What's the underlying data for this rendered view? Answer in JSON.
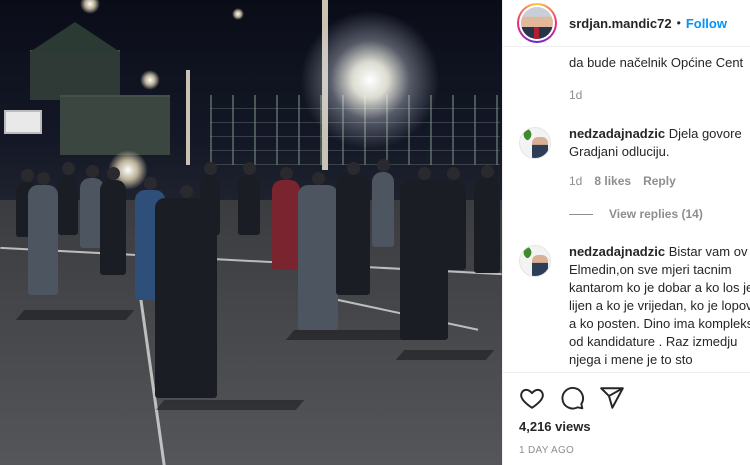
{
  "post": {
    "username": "srdjan.mandic72",
    "separator": "•",
    "follow_label": "Follow"
  },
  "caption": {
    "truncated_text": "da bude načelnik Općine Cent",
    "time": "1d"
  },
  "comments": [
    {
      "author": "nedzadajnadzic",
      "text": "Djela govore Gradjani odluciju.",
      "time": "1d",
      "likes": "8 likes",
      "reply_label": "Reply",
      "view_replies": "View replies (14)"
    },
    {
      "author": "nedzadajnadzic",
      "text": "Bistar vam ov Elmedin,on sve mjeri tacnim kantarom ko je dobar a ko los je lijen a ko je vrijedan, ko je lopov a ko posten. Dino ima kompleks od kandidature . Raz izmedju njega i mene je to sto"
    }
  ],
  "actions": {
    "views": "4,216 views",
    "posted": "1 DAY AGO"
  },
  "icons": {
    "like": "heart-icon",
    "comment": "comment-icon",
    "share": "share-icon"
  },
  "colors": {
    "accent": "#0095f6",
    "muted": "#8e8e8e",
    "text": "#262626"
  }
}
